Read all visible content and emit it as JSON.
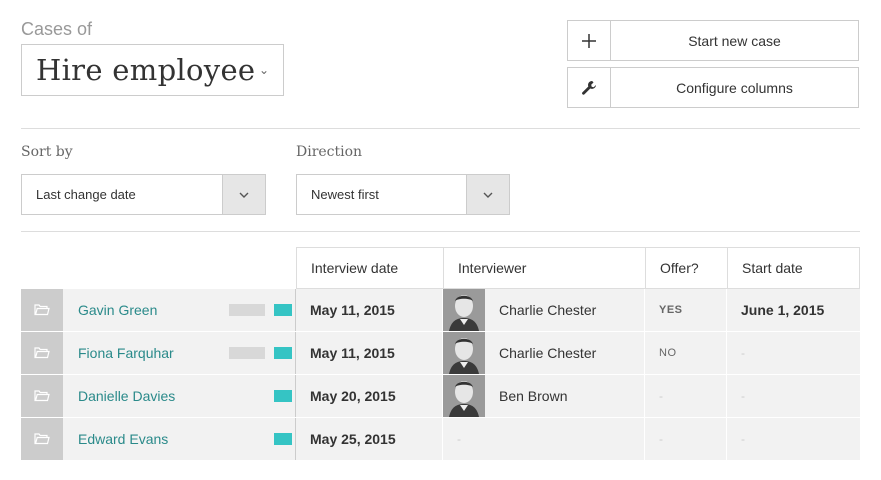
{
  "header": {
    "cases_of": "Cases of",
    "workflow": "Hire employee"
  },
  "actions": {
    "start_new_case": "Start new case",
    "configure_columns": "Configure columns"
  },
  "sorting": {
    "sort_by_label": "Sort by",
    "sort_by_value": "Last change date",
    "direction_label": "Direction",
    "direction_value": "Newest first"
  },
  "table": {
    "columns": [
      "Interview date",
      "Interviewer",
      "Offer?",
      "Start date"
    ],
    "rows": [
      {
        "name": "Gavin Green",
        "progress": 0.5,
        "interview_date": "May 11, 2015",
        "interviewer": "Charlie Chester",
        "offer": "YES",
        "start_date": "June 1, 2015"
      },
      {
        "name": "Fiona Farquhar",
        "progress": 0.5,
        "interview_date": "May 11, 2015",
        "interviewer": "Charlie Chester",
        "offer": "NO",
        "start_date": "-"
      },
      {
        "name": "Danielle Davies",
        "progress": 1.0,
        "interview_date": "May 20, 2015",
        "interviewer": "Ben Brown",
        "offer": "-",
        "start_date": "-"
      },
      {
        "name": "Edward Evans",
        "progress": 1.0,
        "interview_date": "May 25, 2015",
        "interviewer": "-",
        "offer": "-",
        "start_date": "-"
      }
    ]
  },
  "colors": {
    "accent": "#35c4c4",
    "link": "#2a8a8a"
  }
}
